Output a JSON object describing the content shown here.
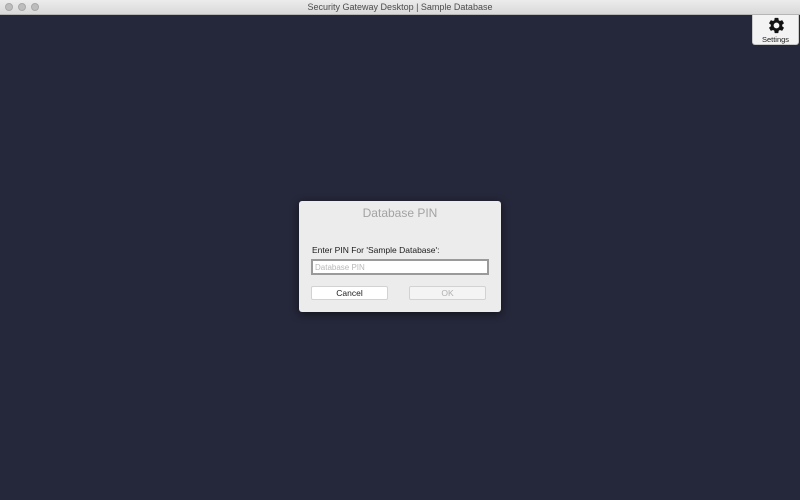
{
  "window": {
    "title": "Security Gateway Desktop | Sample Database"
  },
  "toolbar": {
    "settings_label": "Settings",
    "settings_icon": "gear-icon"
  },
  "dialog": {
    "title": "Database PIN",
    "prompt": "Enter PIN For 'Sample Database':",
    "pin_field": {
      "value": "",
      "placeholder": "Database PIN"
    },
    "cancel_label": "Cancel",
    "ok_label": "OK",
    "ok_enabled": false
  },
  "colors": {
    "background": "#25273a",
    "dialog_bg": "#ececec",
    "titlebar_bg": "#e3e3e3"
  }
}
